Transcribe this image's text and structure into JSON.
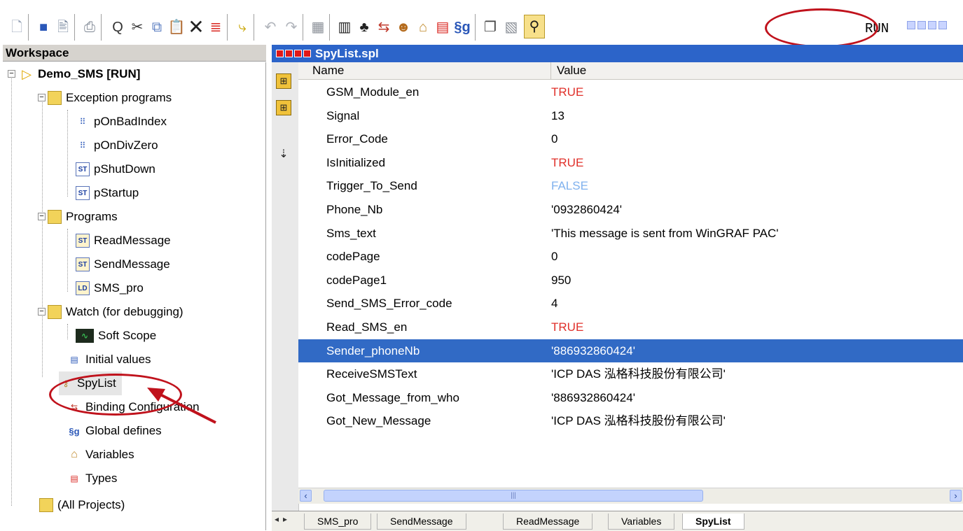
{
  "toolbar": {
    "run_text": "RUN"
  },
  "workspace": {
    "title": "Workspace",
    "project": "Demo_SMS [RUN]",
    "exception_folder": "Exception programs",
    "exception_items": [
      "pOnBadIndex",
      "pOnDivZero",
      "pShutDown",
      "pStartup"
    ],
    "programs_folder": "Programs",
    "program_items": [
      "ReadMessage",
      "SendMessage",
      "SMS_pro"
    ],
    "watch_folder": "Watch (for debugging)",
    "soft_scope": "Soft Scope",
    "initial_values": "Initial values",
    "spylist": "SpyList",
    "binding": "Binding Configuration",
    "global_defines": "Global defines",
    "variables": "Variables",
    "types": "Types",
    "all_projects": "(All Projects)"
  },
  "panel": {
    "title": "SpyList.spl",
    "col_name": "Name",
    "col_value": "Value",
    "rows": [
      {
        "name": "GSM_Module_en",
        "value": "TRUE"
      },
      {
        "name": "Signal",
        "value": "13"
      },
      {
        "name": "Error_Code",
        "value": "0"
      },
      {
        "name": "IsInitialized",
        "value": "TRUE"
      },
      {
        "name": "Trigger_To_Send",
        "value": "FALSE"
      },
      {
        "name": "Phone_Nb",
        "value": "'0932860424'"
      },
      {
        "name": "Sms_text",
        "value": "'This message is sent from WinGRAF PAC'"
      },
      {
        "name": "codePage",
        "value": "0"
      },
      {
        "name": "codePage1",
        "value": "950"
      },
      {
        "name": "Send_SMS_Error_code",
        "value": "4"
      },
      {
        "name": "Read_SMS_en",
        "value": "TRUE"
      },
      {
        "name": "Sender_phoneNb",
        "value": "'886932860424'"
      },
      {
        "name": "ReceiveSMSText",
        "value": "'ICP DAS 泓格科技股份有限公司'"
      },
      {
        "name": "Got_Message_from_who",
        "value": "'886932860424'"
      },
      {
        "name": "Got_New_Message",
        "value": "'ICP DAS 泓格科技股份有限公司'"
      }
    ],
    "selected_row": 11
  },
  "tabs": [
    "SMS_pro",
    "SendMessage",
    "ReadMessage",
    "Variables",
    "SpyList"
  ],
  "active_tab": "SpyList",
  "colors": {
    "true_value": "#e0302a",
    "false_value": "#7fb1ee",
    "title_bar": "#2c64c9",
    "selection": "#316ac5",
    "annotation": "#c0121c"
  },
  "icons": [
    "new-file-icon",
    "save-icon",
    "edit-icon",
    "print-icon",
    "find-icon",
    "cut-icon",
    "copy-icon",
    "paste-icon",
    "delete-icon",
    "clear-icon",
    "insert-icon",
    "undo-icon",
    "redo-icon",
    "compile-icon",
    "grid-icon",
    "tree-icon",
    "binding-icon",
    "spy-icon",
    "home-icon",
    "types-icon",
    "global-defines-icon",
    "window-icon",
    "build-icon",
    "run-icon"
  ]
}
